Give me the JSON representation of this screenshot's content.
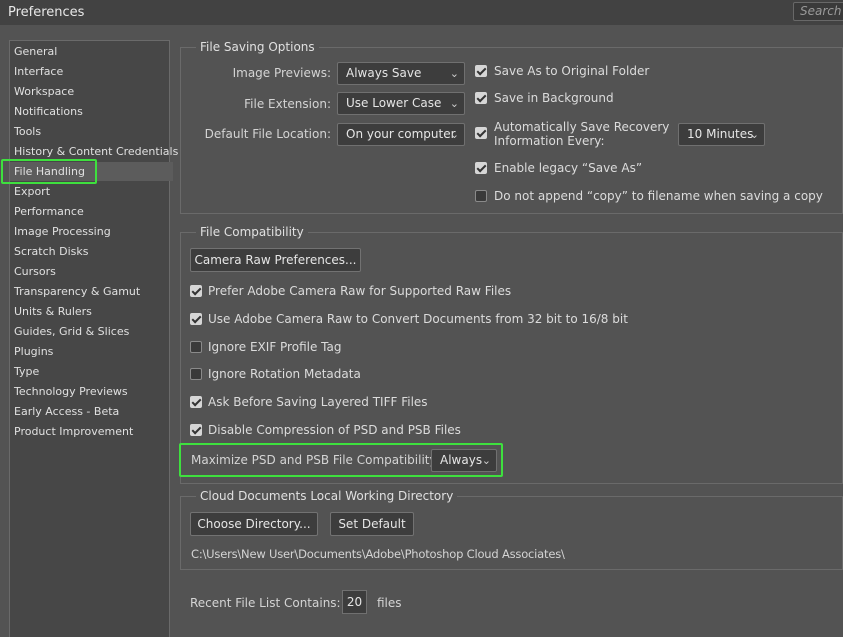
{
  "window": {
    "title": "Preferences",
    "search_placeholder": "Search"
  },
  "sidebar": {
    "items": [
      {
        "label": "General"
      },
      {
        "label": "Interface"
      },
      {
        "label": "Workspace"
      },
      {
        "label": "Notifications"
      },
      {
        "label": "Tools"
      },
      {
        "label": "History & Content Credentials"
      },
      {
        "label": "File Handling"
      },
      {
        "label": "Export"
      },
      {
        "label": "Performance"
      },
      {
        "label": "Image Processing"
      },
      {
        "label": "Scratch Disks"
      },
      {
        "label": "Cursors"
      },
      {
        "label": "Transparency & Gamut"
      },
      {
        "label": "Units & Rulers"
      },
      {
        "label": "Guides, Grid & Slices"
      },
      {
        "label": "Plugins"
      },
      {
        "label": "Type"
      },
      {
        "label": "Technology Previews"
      },
      {
        "label": "Early Access - Beta"
      },
      {
        "label": "Product Improvement"
      }
    ],
    "selected": "File Handling"
  },
  "file_saving": {
    "title": "File Saving Options",
    "image_previews_label": "Image Previews:",
    "image_previews_value": "Always Save",
    "file_extension_label": "File Extension:",
    "file_extension_value": "Use Lower Case",
    "default_location_label": "Default File Location:",
    "default_location_value": "On your computer",
    "save_original_folder": {
      "label": "Save As to Original Folder",
      "checked": true
    },
    "save_background": {
      "label": "Save in Background",
      "checked": true
    },
    "auto_save_recovery": {
      "label_line1": "Automatically Save Recovery",
      "label_line2": "Information Every:",
      "checked": true
    },
    "recovery_interval": "10 Minutes",
    "legacy_save_as": {
      "label": "Enable legacy “Save As”",
      "checked": true
    },
    "no_append_copy": {
      "label": "Do not append “copy” to filename when saving a copy",
      "checked": false
    }
  },
  "file_compat": {
    "title": "File Compatibility",
    "camera_raw_button": "Camera Raw Preferences...",
    "options": [
      {
        "label": "Prefer Adobe Camera Raw for Supported Raw Files",
        "checked": true
      },
      {
        "label": "Use Adobe Camera Raw to Convert Documents from 32 bit to 16/8 bit",
        "checked": true
      },
      {
        "label": "Ignore EXIF Profile Tag",
        "checked": false
      },
      {
        "label": "Ignore Rotation Metadata",
        "checked": false
      },
      {
        "label": "Ask Before Saving Layered TIFF Files",
        "checked": true
      },
      {
        "label": "Disable Compression of PSD and PSB Files",
        "checked": true
      }
    ],
    "maximize_label": "Maximize PSD and PSB File Compatibility:",
    "maximize_value": "Always"
  },
  "cloud": {
    "title": "Cloud Documents Local Working Directory",
    "choose_button": "Choose Directory...",
    "default_button": "Set Default",
    "path": "C:\\Users\\New User\\Documents\\Adobe\\Photoshop Cloud Associates\\"
  },
  "recent": {
    "label": "Recent File List Contains:",
    "value": "20",
    "suffix": "files"
  },
  "colors": {
    "background": "#535353",
    "titlebar": "#424242",
    "highlight": "#3ee03e"
  }
}
